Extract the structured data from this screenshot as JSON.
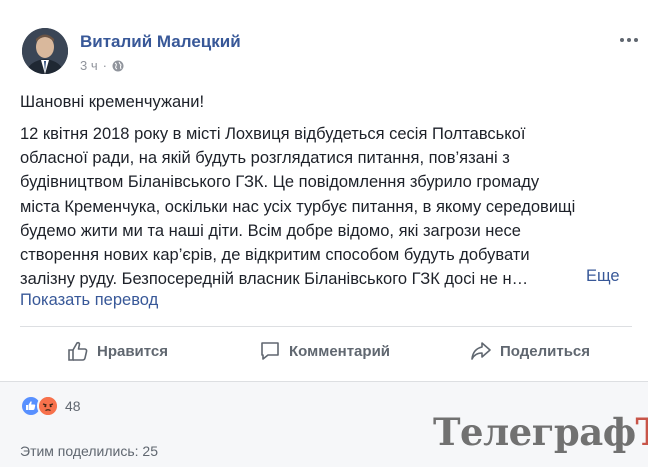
{
  "post": {
    "author_name": "Виталий Малецкий",
    "timestamp": "3 ч",
    "privacy_icon": "globe-icon",
    "greeting": "Шановні кременчужани!",
    "body_lines": [
      "12 квітня 2018 року в місті Лохвиця відбудеться сесія Полтавської",
      "обласної ради, на якій будуть розглядатися питання, пов’язані з",
      "будівництвом Біланівського ГЗК. Це повідомлення збурило громаду",
      "міста Кременчука, оскільки нас усіх турбує питання, в якому середовищі",
      "будемо жити ми та наші діти. Всім добре відомо, які загрози несе",
      "створення нових кар’єрів, де відкритим способом будуть добувати",
      "залізну руду. Безпосередній власник Біланівського ГЗК досі не н…"
    ],
    "see_more": "Еще",
    "translate": "Показать перевод"
  },
  "actions": {
    "like": "Нравится",
    "comment": "Комментарий",
    "share": "Поделиться"
  },
  "summary": {
    "reaction_count": "48",
    "reactions": [
      "like",
      "angry"
    ],
    "shares": "Этим поделились: 25"
  },
  "watermark": {
    "main": "Телеграф",
    "accent": "Ъ"
  },
  "colors": {
    "link": "#385898",
    "text": "#1d2129",
    "muted": "#606770",
    "like_blue": "#5890ff",
    "angry_orange": "#f7714c"
  }
}
